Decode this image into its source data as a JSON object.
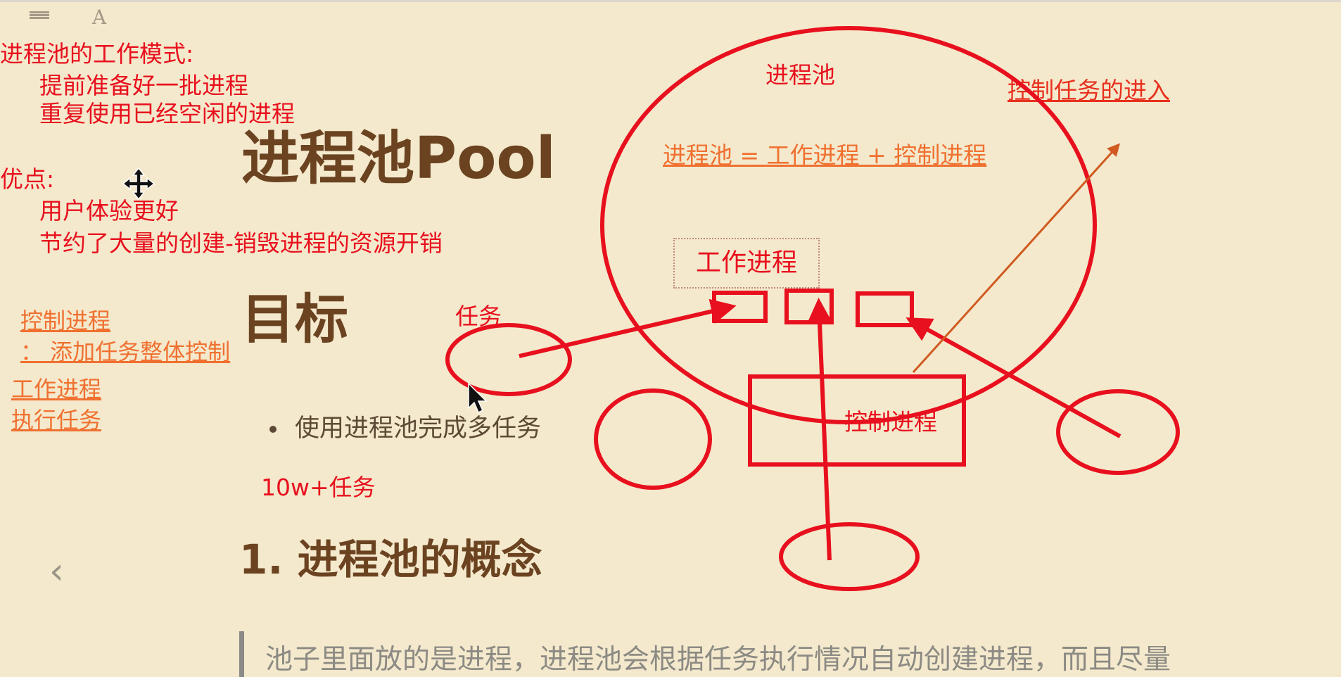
{
  "toolbar": {
    "menu_icon": "hamburger-menu-icon",
    "font_icon_label": "A"
  },
  "document": {
    "title": "进程池Pool",
    "goal_heading": "目标",
    "bullet": "使用进程池完成多任务",
    "section_heading": "1. 进程池的概念",
    "quote": "池子里面放的是进程，进程池会根据任务执行情况自动创建进程，而且尽量"
  },
  "annotations": {
    "mode_title": "进程池的工作模式:",
    "mode_items": [
      "提前准备好一批进程",
      "重复使用已经空闲的进程"
    ],
    "pros_title": "优点:",
    "pros_items": [
      "用户体验更好",
      "节约了大量的创建-销毁进程的资源开销"
    ],
    "control_label": "控制进程",
    "control_desc": "：  添加任务整体控制",
    "worker_label": "工作进程",
    "worker_desc": "执行任务",
    "task_label": "任务",
    "count_label": "10w+任务",
    "pool_label": "进程池",
    "pool_formula": "进程池 = 工作进程 + 控制进程",
    "control_entry": "控制任务的进入",
    "worker_box_label": "工作进程",
    "control_box_label": "控制进程"
  },
  "colors": {
    "pen_red": "#e8101e",
    "pen_orange": "#f07030",
    "heading_brown": "#6b4321",
    "background": "#f4e9cc"
  },
  "nav": {
    "prev_icon": "chevron-left-icon"
  }
}
